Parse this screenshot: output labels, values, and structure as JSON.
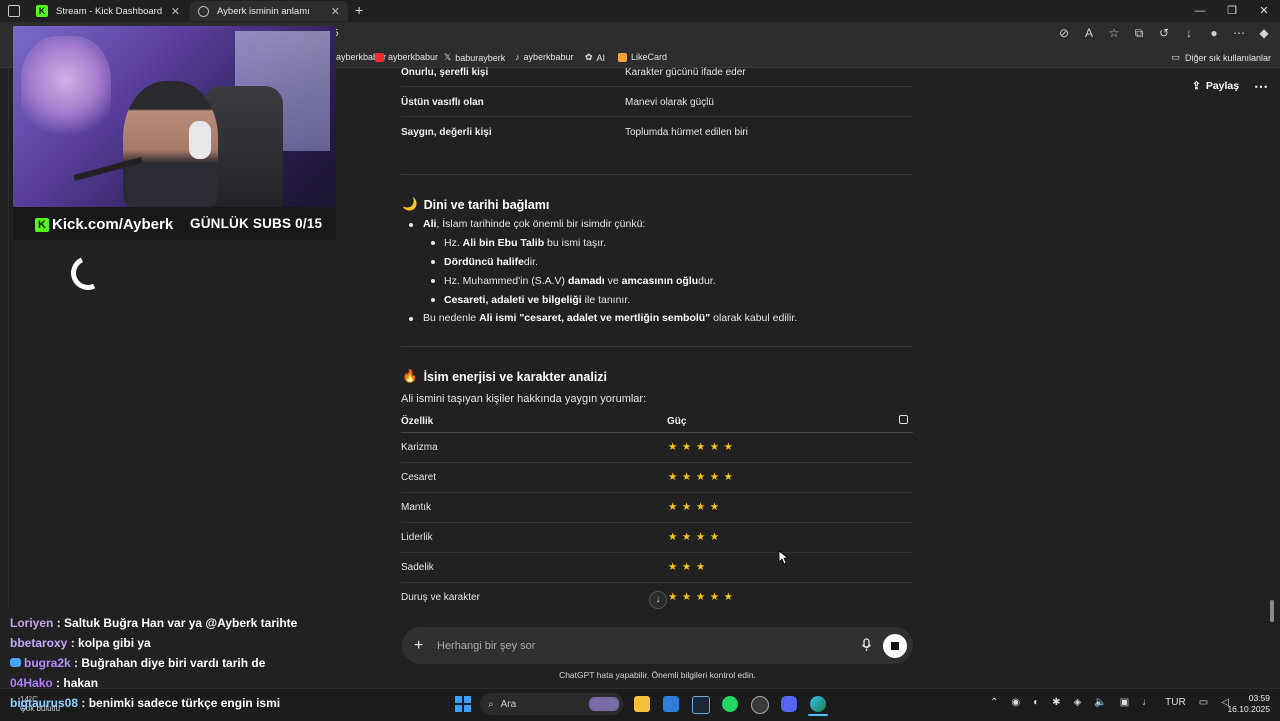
{
  "browser": {
    "tabs": [
      {
        "label": "Stream - Kick Dashboard",
        "active": false
      },
      {
        "label": "Ayberk isminin anlamı",
        "active": true
      }
    ],
    "new_tab": "+",
    "url_fragment": "5",
    "bookmarks": [
      "ayberkbabur",
      "ayberkbabur",
      "baburayberk",
      "ayberkbabur",
      "AI",
      "LikeCard"
    ],
    "other_bookmarks": "Diğer sık kullanılanlar"
  },
  "overlay": {
    "kick_handle": "Kick.com/Ayberk",
    "subs_label": "GÜNLÜK SUBS 0/15"
  },
  "chat": [
    {
      "user": "Loriyen",
      "user_color": "#c4a5e8",
      "message": ": Saltuk Buğra Han var ya @Ayberk tarihte"
    },
    {
      "user": "bbetaroxy",
      "user_color": "#c9a8ff",
      "message": ": kolpa gibi ya"
    },
    {
      "user": "bugra2k",
      "user_color": "#b88cff",
      "message": ": Buğrahan diye biri vardı tarih de"
    },
    {
      "user": "04Hako",
      "user_color": "#b07cff",
      "message": ": hakan"
    },
    {
      "user": "bigtaurus08",
      "user_color": "#8bd3ff",
      "message": ": benimki sadece türkçe engin ismi"
    }
  ],
  "header": {
    "share_label": "Paylaş",
    "more_label": "⋯"
  },
  "table1": [
    {
      "left": "Onurlu, şerefli kişi",
      "right": "Karakter gücünü ifade eder"
    },
    {
      "left": "Üstün vasıflı olan",
      "right": "Manevi olarak güçlü"
    },
    {
      "left": "Saygın, değerli kişi",
      "right": "Toplumda hürmet edilen biri"
    }
  ],
  "section1": {
    "emoji": "🌙",
    "title": "Dini ve tarihi bağlamı",
    "intro_bold": "Ali",
    "intro_rest": ", İslam tarihinde çok önemli bir isimdir çünkü:",
    "sub": [
      {
        "pre": "Hz. ",
        "bold": "Ali bin Ebu Talib",
        "post": " bu ismi taşır."
      },
      {
        "pre": "",
        "bold": "Dördüncü halife",
        "post": "dir."
      },
      {
        "pre": "Hz. Muhammed'in (S.A.V) ",
        "bold": "damadı",
        "mid": " ve ",
        "bold2": "amcasının oğlu",
        "post": "dur."
      },
      {
        "pre": "",
        "bold": "Cesareti, adaleti ve bilgeliği",
        "post": " ile tanınır."
      }
    ],
    "outro_pre": "Bu nedenle ",
    "outro_bold": "Ali ismi \"cesaret, adalet ve mertliğin sembolü\"",
    "outro_post": " olarak kabul edilir."
  },
  "section2": {
    "emoji": "🔥",
    "title": "İsim enerjisi ve karakter analizi",
    "intro": "Ali ismini taşıyan kişiler hakkında yaygın yorumlar:",
    "col1": "Özellik",
    "col2": "Güç",
    "rows": [
      {
        "trait": "Karizma",
        "stars": "★★★★★",
        "rating": 5
      },
      {
        "trait": "Cesaret",
        "stars": "★★★★★",
        "rating": 5
      },
      {
        "trait": "Mantık",
        "stars": "★★★★",
        "rating": 4
      },
      {
        "trait": "Liderlik",
        "stars": "★★★★",
        "rating": 4
      },
      {
        "trait": "Sadelik",
        "stars": "★★★",
        "rating": 3
      },
      {
        "trait": "Duruş ve karakter",
        "stars": "★★★★★",
        "rating": 5
      }
    ]
  },
  "composer": {
    "placeholder": "Herhangi bir şey sor",
    "plus": "+"
  },
  "disclaimer": "ChatGPT hata yapabilir. Önemli bilgileri kontrol edin.",
  "taskbar": {
    "weather_temp": "14°C",
    "weather_desc": "Çok bulutlu",
    "search_label": "Ara",
    "lang": "TUR",
    "time": "03:59",
    "date": "16.10.2025"
  },
  "colors": {
    "star": "#f5c518",
    "kick_green": "#53fc18",
    "page_bg": "#212121"
  }
}
